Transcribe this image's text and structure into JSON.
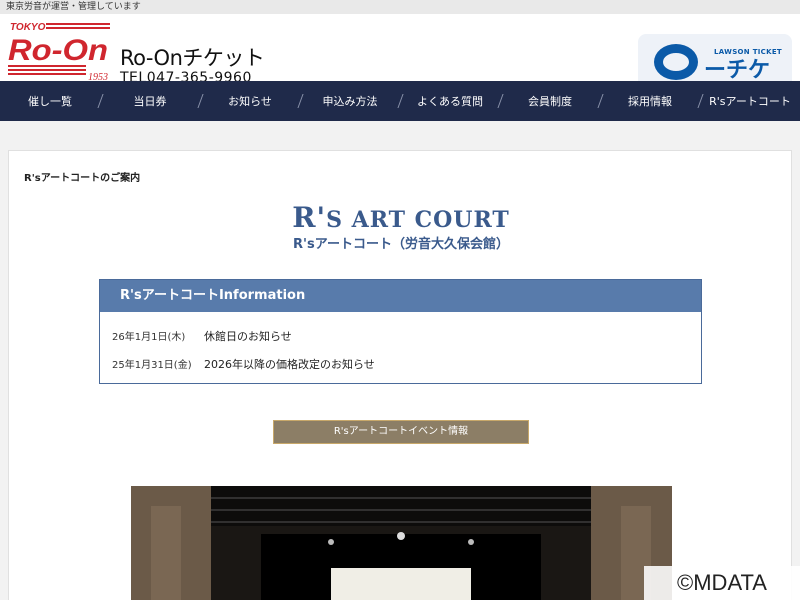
{
  "topbar": {
    "text": "東京労音が運営・管理しています"
  },
  "header": {
    "logo": {
      "tokyo": "TOKYO",
      "roon": "Ro-On",
      "year": "1953"
    },
    "brand_name": "Ro-Onチケット",
    "tel": "TEL047-365-9960",
    "lawson": {
      "top": "LAWSON TICKET",
      "mark": "ーチケ"
    }
  },
  "nav": {
    "items": [
      {
        "label": "催し一覧"
      },
      {
        "label": "当日券"
      },
      {
        "label": "お知らせ"
      },
      {
        "label": "申込み方法"
      },
      {
        "label": "よくある質問"
      },
      {
        "label": "会員制度"
      },
      {
        "label": "採用情報"
      },
      {
        "label": "R'sアートコート"
      }
    ]
  },
  "main": {
    "section_title": "R'sアートコートのご案内",
    "venue_logo": {
      "r": "R'",
      "rest": "S ART COURT"
    },
    "venue_name": "R'sアートコート（労音大久保会館）",
    "info": {
      "title": "R'sアートコートInformation",
      "rows": [
        {
          "date": "26年1月1日(木)",
          "text": "休館日のお知らせ"
        },
        {
          "date": "25年1月31日(金)",
          "text": "2026年以降の価格改定のお知らせ"
        }
      ]
    },
    "event_button": "R'sアートコートイベント情報"
  },
  "watermark": "©MDATA",
  "colors": {
    "nav_bg": "#1f2a4a",
    "accent_blue": "#587bab",
    "logo_red": "#d0262e",
    "lawson_blue": "#0b5aa8",
    "button_bg": "#8c7e66"
  }
}
